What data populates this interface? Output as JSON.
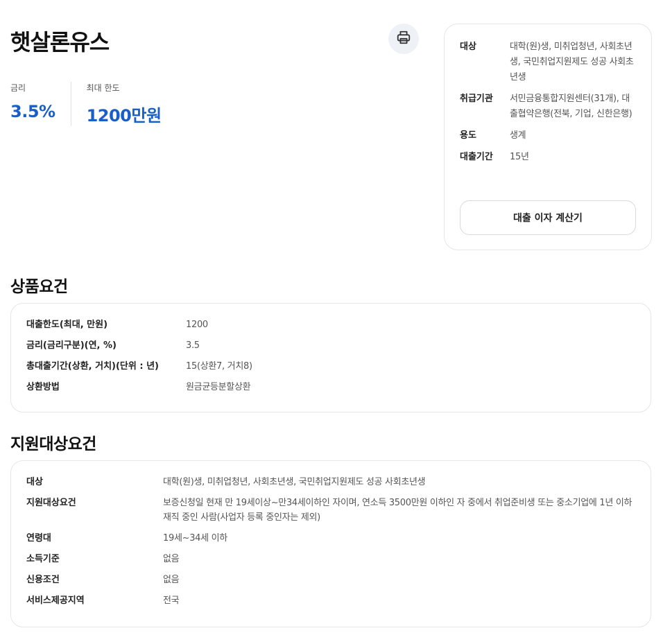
{
  "product": {
    "title": "햇살론유스"
  },
  "stats": {
    "rate_label": "금리",
    "rate_value": "3.5%",
    "limit_label": "최대 한도",
    "limit_value": "1200만원"
  },
  "summary": {
    "rows": [
      {
        "label": "대상",
        "value": "대학(원)생, 미취업청년, 사회초년생, 국민취업지원제도 성공 사회초년생"
      },
      {
        "label": "취급기관",
        "value": "서민금융통합지원센터(31개), 대출협약은행(전북, 기업, 신한은행)"
      },
      {
        "label": "용도",
        "value": "생계"
      },
      {
        "label": "대출기간",
        "value": "15년"
      }
    ],
    "calculator_button": "대출 이자 계산기"
  },
  "product_requirements": {
    "title": "상품요건",
    "rows": [
      {
        "label": "대출한도(최대, 만원)",
        "value": "1200"
      },
      {
        "label": "금리(금리구분)(연, %)",
        "value": "3.5"
      },
      {
        "label": "총대출기간(상환, 거치)(단위 : 년)",
        "value": "15(상환7, 거치8)"
      },
      {
        "label": "상환방법",
        "value": "원금균등분할상환"
      }
    ]
  },
  "eligibility": {
    "title": "지원대상요건",
    "rows": [
      {
        "label": "대상",
        "value": "대학(원)생, 미취업청년, 사회초년생, 국민취업지원제도 성공 사회초년생"
      },
      {
        "label": "지원대상요건",
        "value": "보증신청일 현재 만 19세이상~만34세이하인 자이며, 연소득 3500만원 이하인 자 중에서 취업준비생 또는 중소기업에 1년 이하 재직 중인 사람(사업자 등록 중인자는 제외)"
      },
      {
        "label": "연령대",
        "value": "19세~34세 이하"
      },
      {
        "label": "소득기준",
        "value": "없음"
      },
      {
        "label": "신용조건",
        "value": "없음"
      },
      {
        "label": "서비스제공지역",
        "value": "전국"
      }
    ]
  },
  "icons": {
    "print": "printer-icon"
  },
  "colors": {
    "accent": "#1a5fc7",
    "print_bg": "#eef2f7"
  }
}
